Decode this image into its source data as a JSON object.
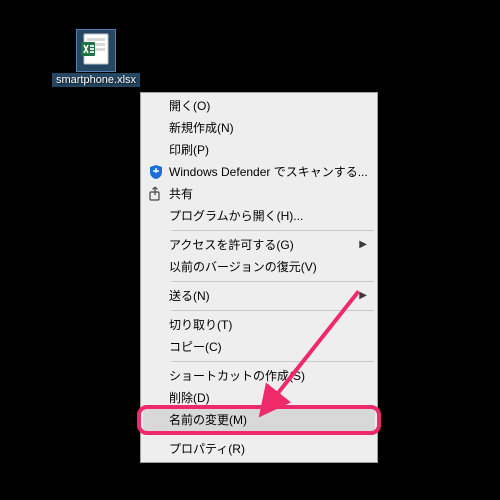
{
  "desktop": {
    "file": {
      "label": "smartphone.xlsx",
      "type": "excel"
    }
  },
  "context_menu": {
    "items": [
      {
        "label": "開く(O)",
        "icon": "",
        "submenu": false
      },
      {
        "label": "新規作成(N)",
        "icon": "",
        "submenu": false
      },
      {
        "label": "印刷(P)",
        "icon": "",
        "submenu": false
      },
      {
        "label": "Windows Defender でスキャンする...",
        "icon": "defender",
        "submenu": false
      },
      {
        "label": "共有",
        "icon": "share",
        "submenu": false
      },
      {
        "label": "プログラムから開く(H)...",
        "icon": "",
        "submenu": false
      },
      {
        "sep": true
      },
      {
        "label": "アクセスを許可する(G)",
        "icon": "",
        "submenu": true
      },
      {
        "label": "以前のバージョンの復元(V)",
        "icon": "",
        "submenu": false
      },
      {
        "sep": true
      },
      {
        "label": "送る(N)",
        "icon": "",
        "submenu": true
      },
      {
        "sep": true
      },
      {
        "label": "切り取り(T)",
        "icon": "",
        "submenu": false
      },
      {
        "label": "コピー(C)",
        "icon": "",
        "submenu": false
      },
      {
        "sep": true
      },
      {
        "label": "ショートカットの作成(S)",
        "icon": "",
        "submenu": false
      },
      {
        "label": "削除(D)",
        "icon": "",
        "submenu": false
      },
      {
        "label": "名前の変更(M)",
        "icon": "",
        "submenu": false,
        "highlight": true
      },
      {
        "sep": true
      },
      {
        "label": "プロパティ(R)",
        "icon": "",
        "submenu": false
      }
    ]
  },
  "annotation": {
    "target_label": "名前の変更(M)",
    "color": "#ef2a6a"
  }
}
